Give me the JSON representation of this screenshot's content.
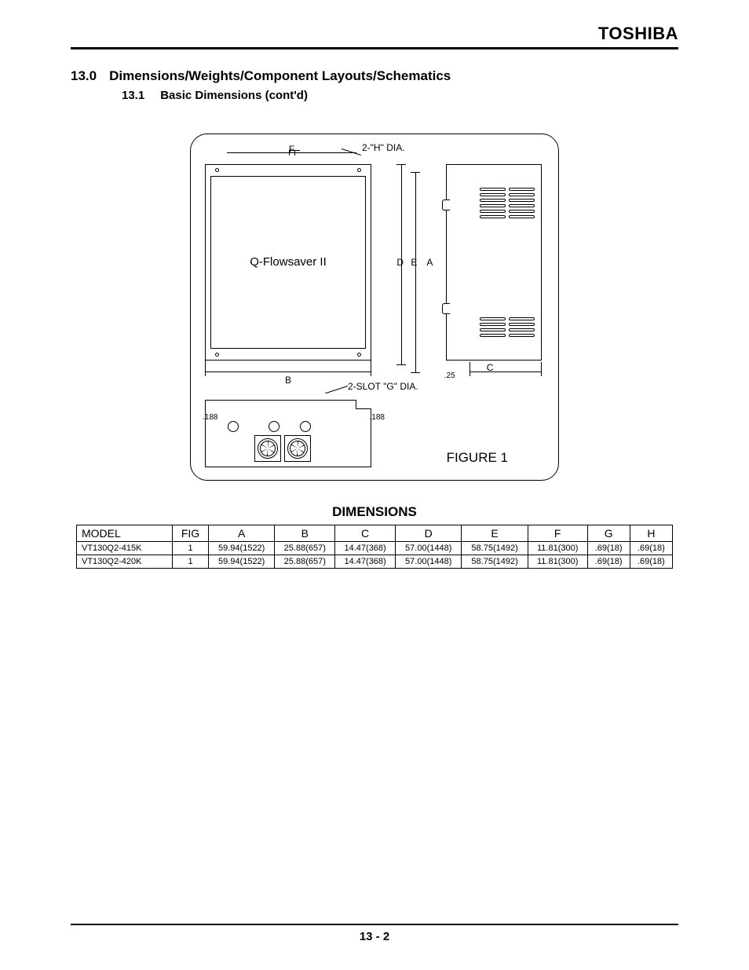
{
  "brand": "TOSHIBA",
  "section": {
    "num": "13.0",
    "title": "Dimensions/Weights/Component Layouts/Schematics"
  },
  "subsection": {
    "num": "13.1",
    "title": "Basic Dimensions (cont'd)"
  },
  "figure": {
    "product_label": "Q-Flowsaver II",
    "h_dia_note": "2-\"H\" DIA.",
    "slot_note": "2-SLOT \"G\" DIA.",
    "dim_F": "F",
    "dim_B": "B",
    "dim_C": "C",
    "dim_D": "D",
    "dim_E": "E",
    "dim_A": "A",
    "dim_25": ".25",
    "dim_188_left": ".188",
    "dim_188_right": ".188",
    "caption": "FIGURE 1"
  },
  "table": {
    "title": "DIMENSIONS",
    "headers": {
      "model": "MODEL",
      "fig": "FIG",
      "A": "A",
      "B": "B",
      "C": "C",
      "D": "D",
      "E": "E",
      "F": "F",
      "G": "G",
      "H": "H"
    },
    "rows": [
      {
        "model": "VT130Q2-415K",
        "fig": "1",
        "A": "59.94(1522)",
        "B": "25.88(657)",
        "C": "14.47(368)",
        "D": "57.00(1448)",
        "E": "58.75(1492)",
        "F": "11.81(300)",
        "G": ".69(18)",
        "H": ".69(18)"
      },
      {
        "model": "VT130Q2-420K",
        "fig": "1",
        "A": "59.94(1522)",
        "B": "25.88(657)",
        "C": "14.47(368)",
        "D": "57.00(1448)",
        "E": "58.75(1492)",
        "F": "11.81(300)",
        "G": ".69(18)",
        "H": ".69(18)"
      }
    ]
  },
  "page_number": "13 - 2"
}
